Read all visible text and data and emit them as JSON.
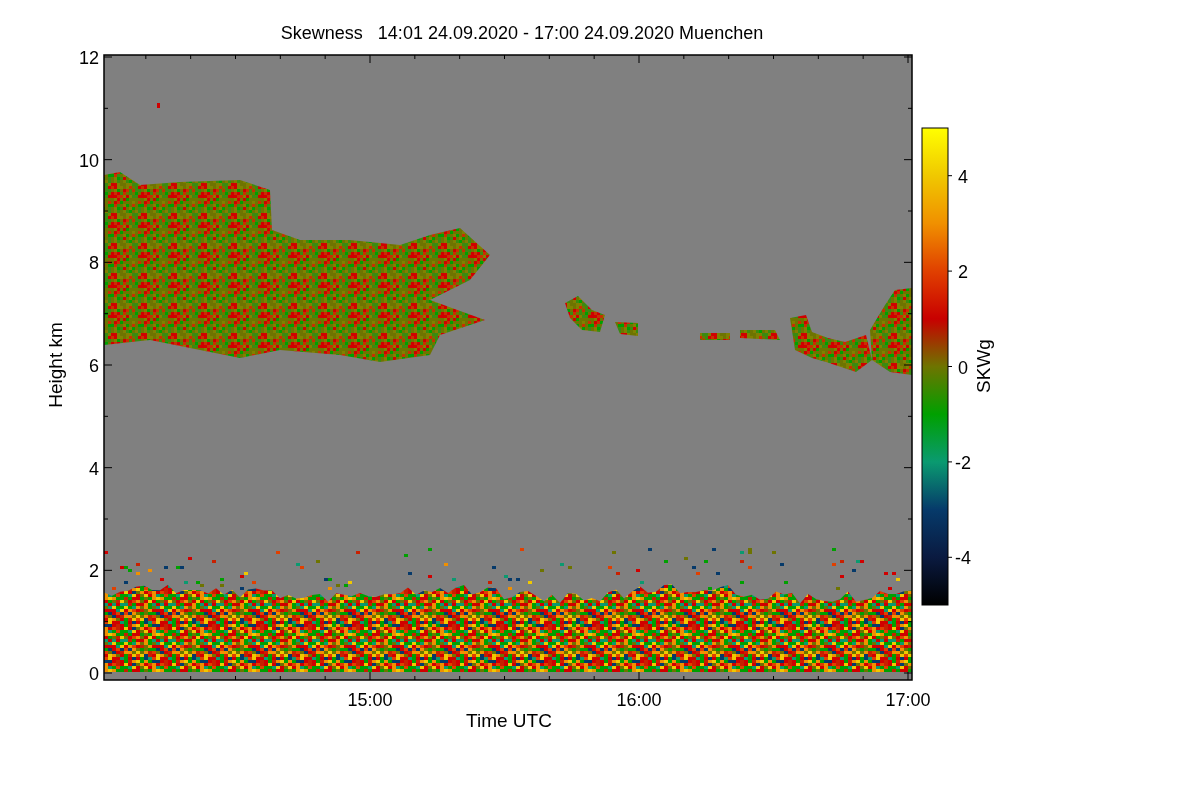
{
  "title": "Skewness   14:01 24.09.2020 - 17:00 24.09.2020 Muenchen",
  "plot": {
    "ylabel": "Height km",
    "xlabel": "Time UTC",
    "yticks": [
      "12",
      "10",
      "8",
      "6",
      "4",
      "2",
      "0"
    ],
    "xticks": [
      "15:00",
      "16:00",
      "17:00"
    ]
  },
  "colorbar": {
    "label": "SKWg",
    "ticks": [
      "4",
      "2",
      "0",
      "-2",
      "-4"
    ]
  }
}
